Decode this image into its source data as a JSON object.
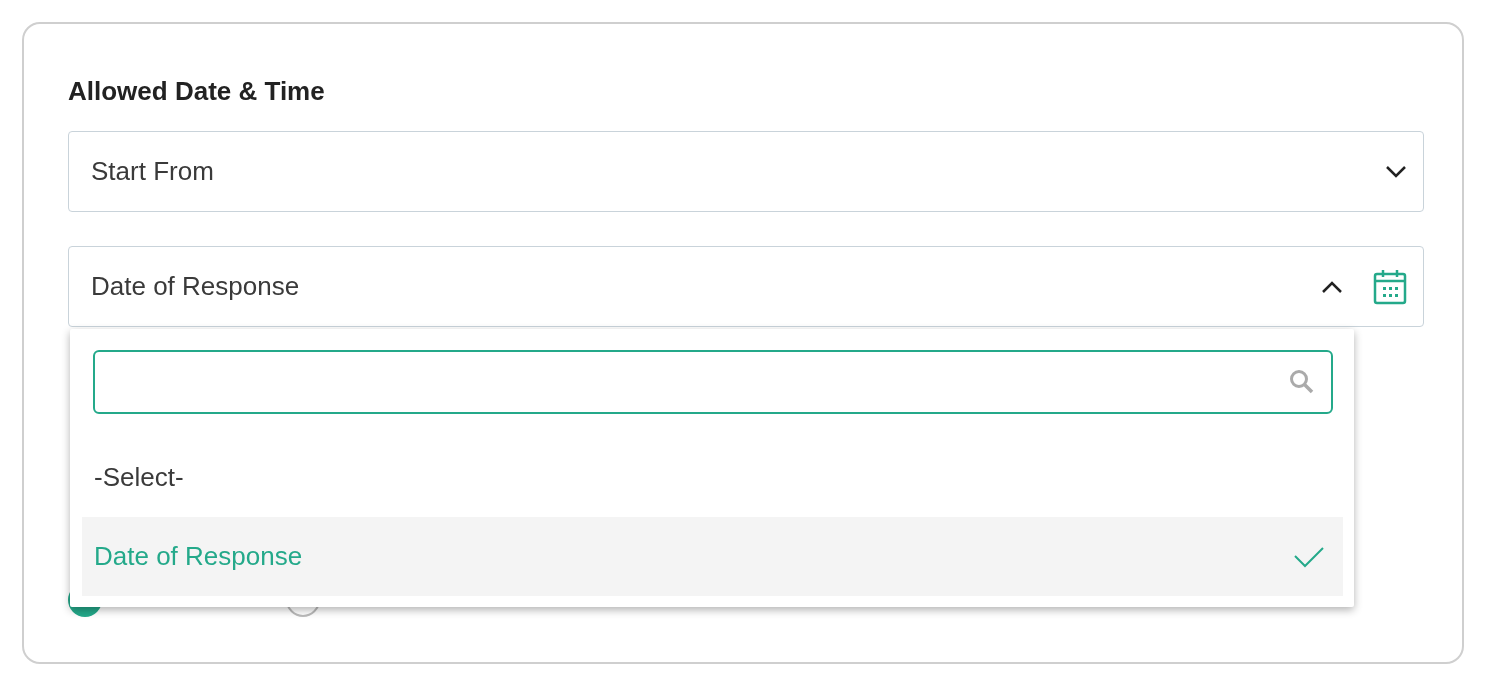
{
  "section": {
    "title": "Allowed Date & Time"
  },
  "start_select": {
    "value": "Start From",
    "expanded": false
  },
  "date_select": {
    "value": "Date of Response",
    "expanded": true
  },
  "dropdown": {
    "options": [
      {
        "label": "-Select-",
        "selected": false
      },
      {
        "label": "Date of Response",
        "selected": true
      }
    ]
  },
  "radios": [
    {
      "selected": true
    },
    {
      "selected": false
    }
  ]
}
